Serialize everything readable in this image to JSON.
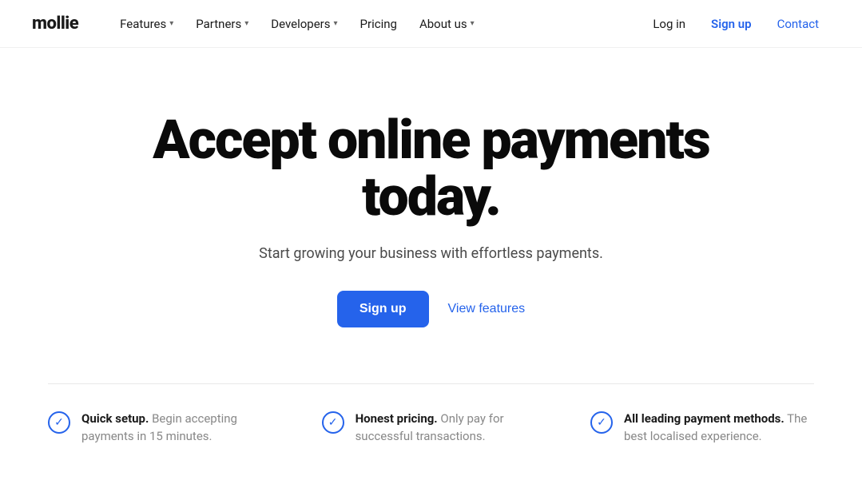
{
  "brand": {
    "logo": "mollie"
  },
  "nav": {
    "links": [
      {
        "label": "Features",
        "has_dropdown": true
      },
      {
        "label": "Partners",
        "has_dropdown": true
      },
      {
        "label": "Developers",
        "has_dropdown": true
      },
      {
        "label": "Pricing",
        "has_dropdown": false
      },
      {
        "label": "About us",
        "has_dropdown": true
      }
    ],
    "login_label": "Log in",
    "signup_label": "Sign up",
    "contact_label": "Contact"
  },
  "hero": {
    "title": "Accept online payments today.",
    "subtitle": "Start growing your business with effortless payments.",
    "signup_button": "Sign up",
    "features_link": "View features"
  },
  "features": [
    {
      "bold": "Quick setup.",
      "text": " Begin accepting payments in 15 minutes."
    },
    {
      "bold": "Honest pricing.",
      "text": " Only pay for successful transactions."
    },
    {
      "bold": "All leading payment methods.",
      "text": " The best localised experience."
    }
  ]
}
